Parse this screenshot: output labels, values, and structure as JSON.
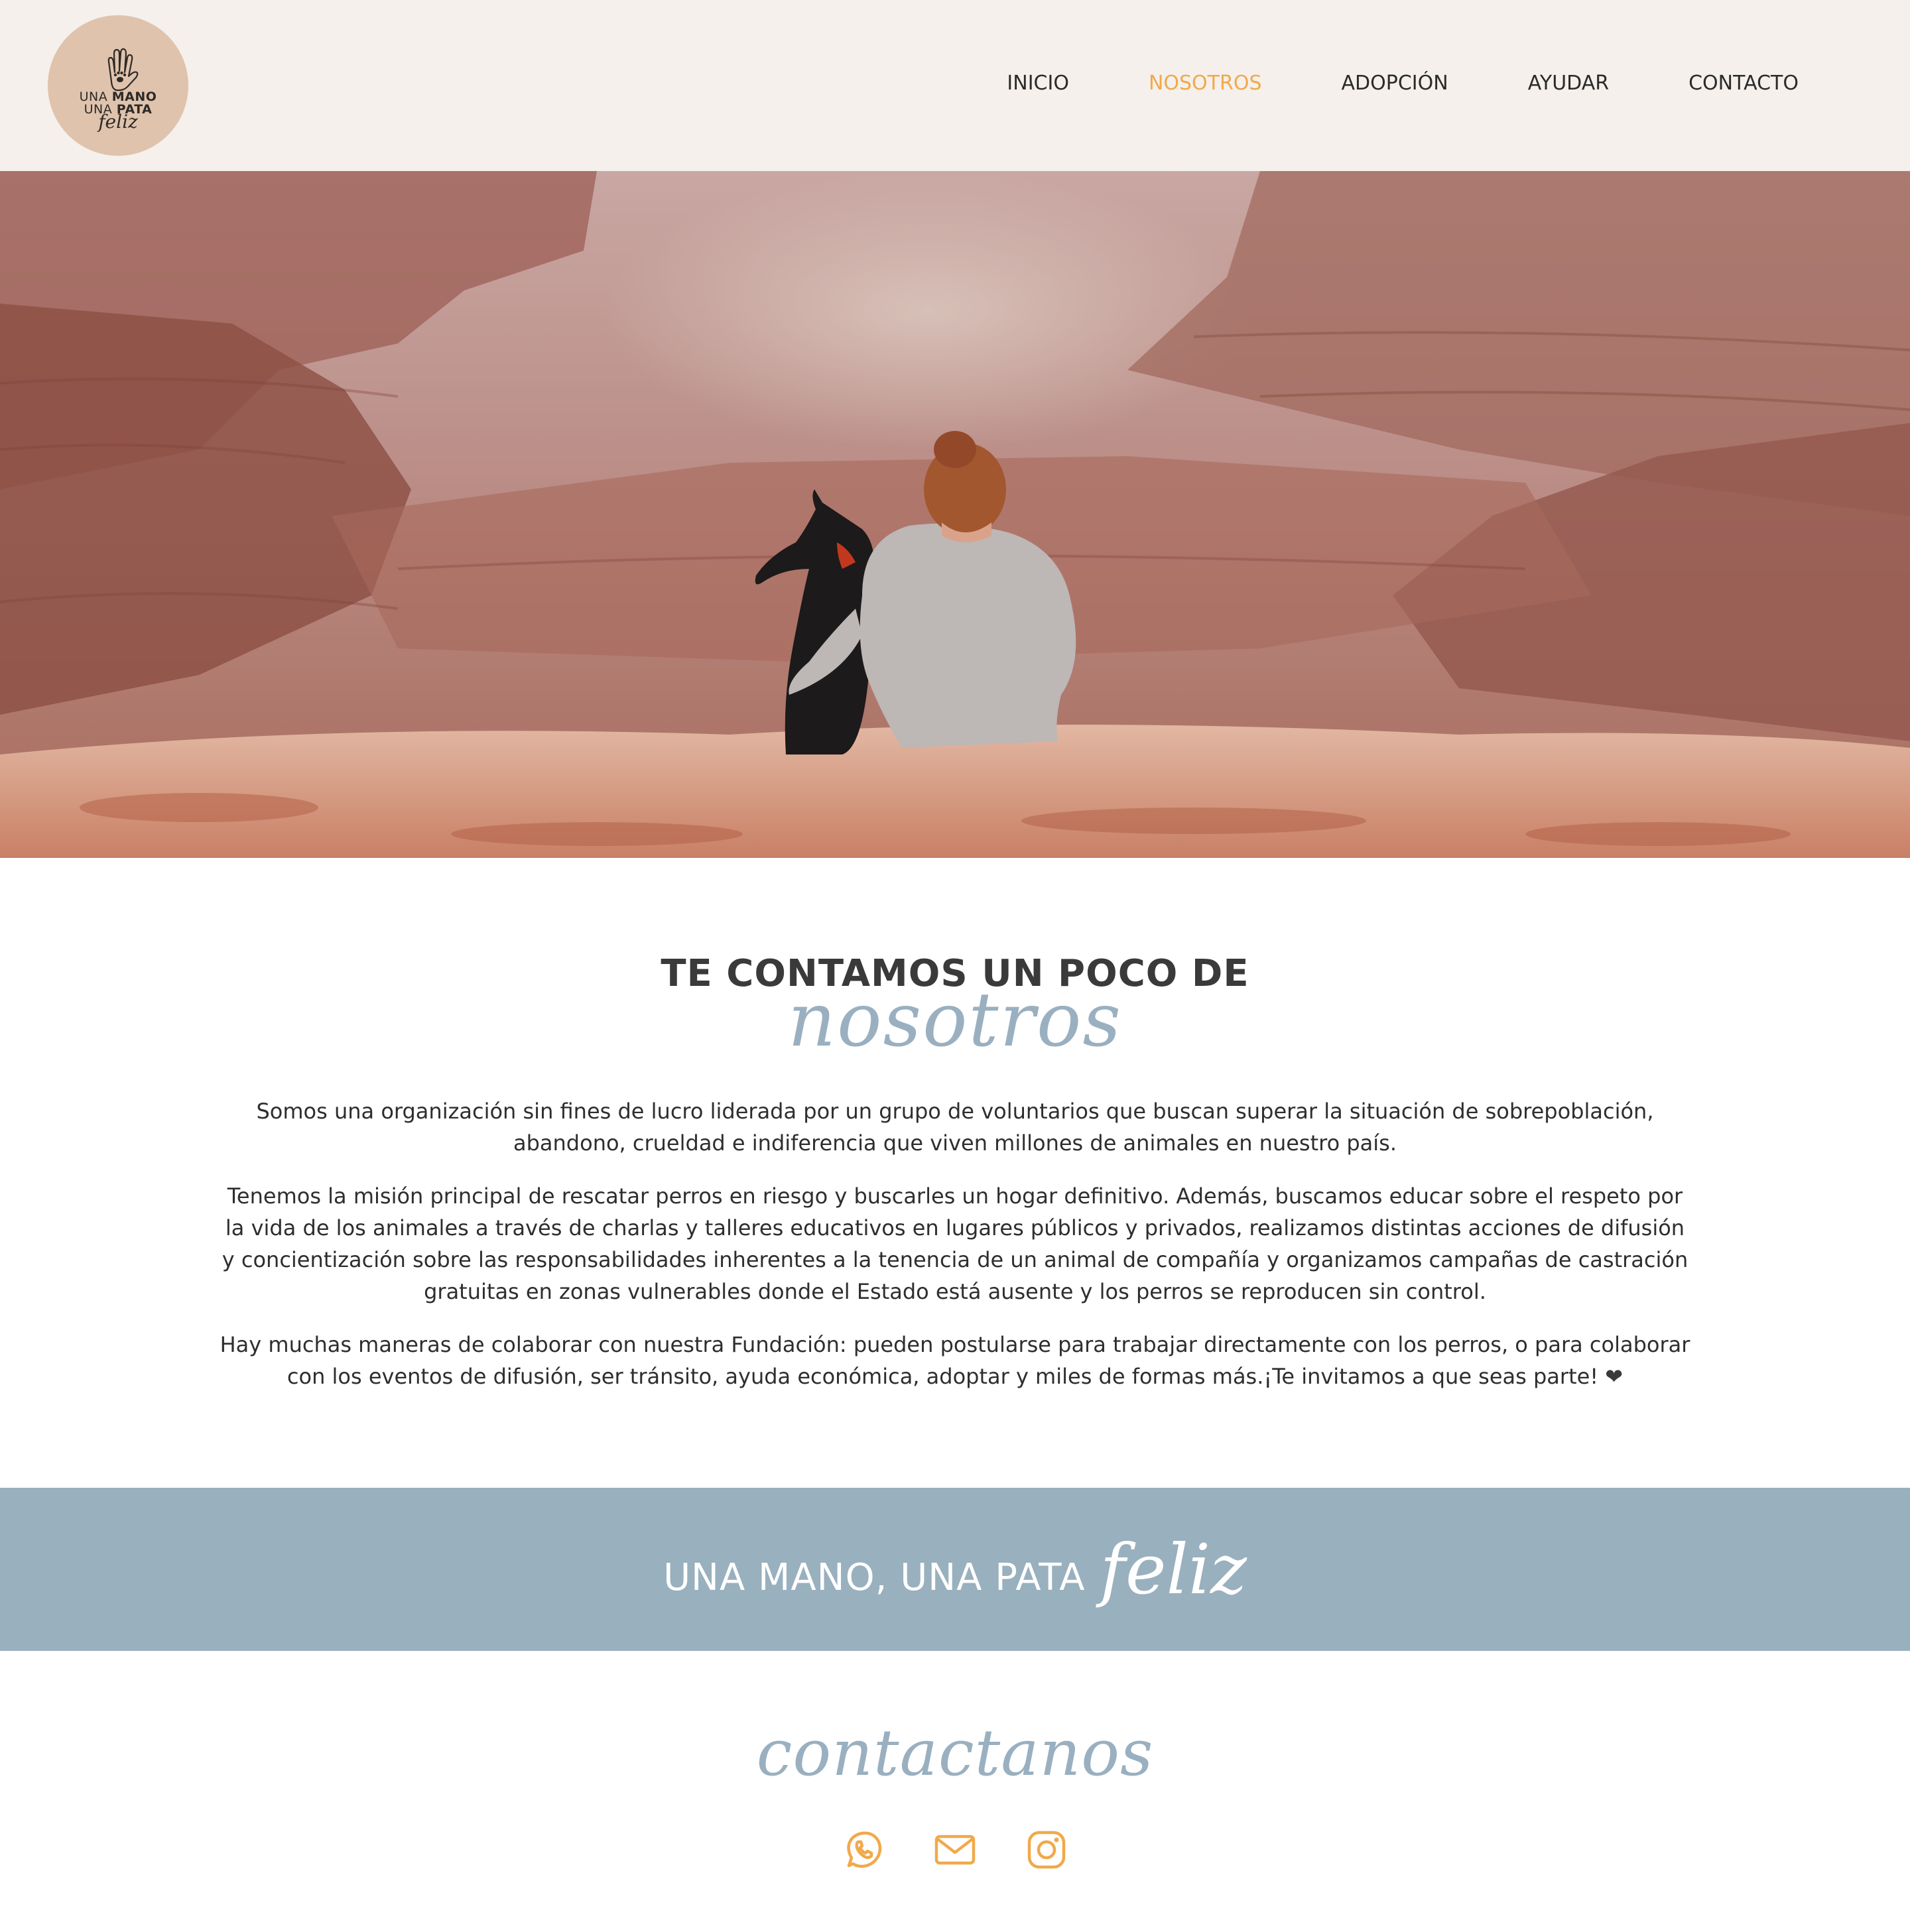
{
  "header": {
    "logo": {
      "line1_a": "UNA ",
      "line1_b": "MANO",
      "line2_a": "UNA ",
      "line2_b": "PATA",
      "line3": "feliz"
    },
    "nav": [
      {
        "label": "INICIO",
        "active": false
      },
      {
        "label": "NOSOTROS",
        "active": true
      },
      {
        "label": "ADOPCIÓN",
        "active": false
      },
      {
        "label": "AYUDAR",
        "active": false
      },
      {
        "label": "CONTACTO",
        "active": false
      }
    ]
  },
  "about": {
    "heading": "TE CONTAMOS UN POCO DE",
    "script": "nosotros",
    "paragraphs": [
      "Somos una organización sin fines de lucro liderada por un grupo de voluntarios que buscan superar la situación de sobrepoblación, abandono, crueldad e indiferencia que viven millones de animales en nuestro país.",
      "Tenemos la misión principal de rescatar perros en riesgo y buscarles un hogar definitivo. Además, buscamos educar sobre el respeto por la vida de los animales a través de charlas y talleres educativos en lugares públicos y privados, realizamos distintas acciones de difusión y concientización sobre las responsabilidades inherentes a la tenencia de un animal de compañía y organizamos campañas de castración gratuitas en zonas vulnerables donde el Estado está ausente y los perros se reproducen sin control.",
      "Hay muchas maneras de colaborar con nuestra Fundación: pueden postularse para trabajar directamente con los perros, o para colaborar con los eventos de difusión, ser tránsito, ayuda económica, adoptar y miles de formas más.¡Te invitamos a que seas parte! "
    ],
    "heart": "❤"
  },
  "banner": {
    "text": "UNA MANO, UNA PATA",
    "script": "feliz"
  },
  "contact": {
    "title": "contactanos",
    "icons": [
      "whatsapp-icon",
      "mail-icon",
      "instagram-icon"
    ]
  },
  "colors": {
    "accent": "#f1a94b",
    "header_bg": "#f5f0eb",
    "logo_bg": "#dfc3ad",
    "banner_bg": "#99b0be",
    "script_blue": "#9ab0c0",
    "text": "#2e2e2e"
  }
}
